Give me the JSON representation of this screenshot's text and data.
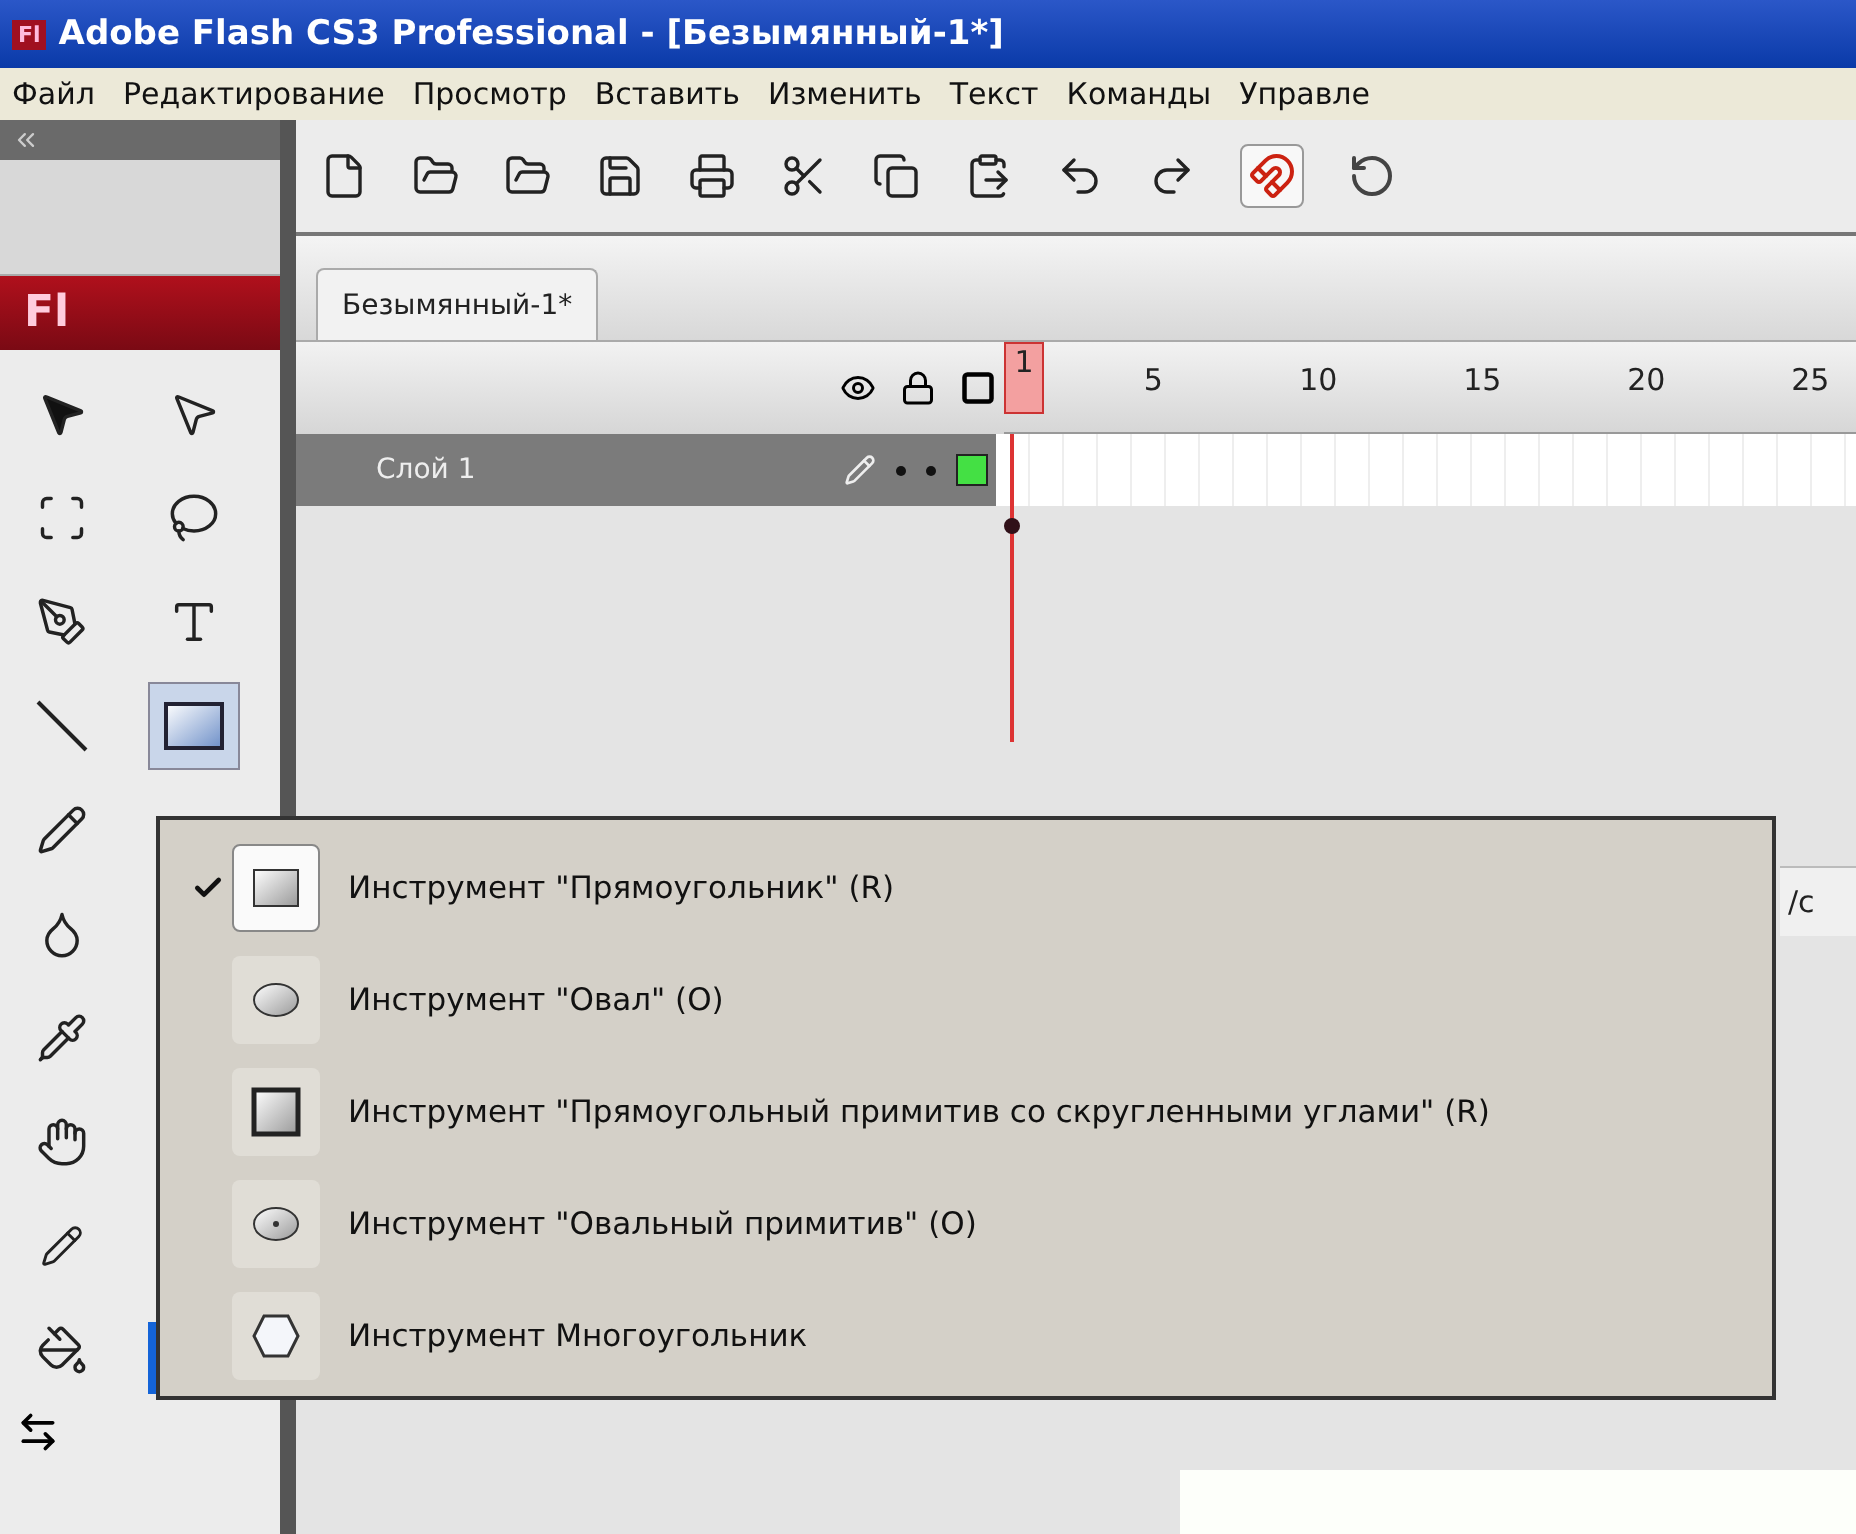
{
  "window": {
    "app_badge": "Fl",
    "title": "Adobe Flash CS3 Professional - [Безымянный-1*]"
  },
  "menu": [
    "Файл",
    "Редактирование",
    "Просмотр",
    "Вставить",
    "Изменить",
    "Текст",
    "Команды",
    "Управле"
  ],
  "tools_panel": {
    "logo": "Fl",
    "tools": [
      {
        "kind": "arrow",
        "selected": false
      },
      {
        "kind": "subselect",
        "selected": false
      },
      {
        "kind": "transform",
        "selected": false
      },
      {
        "kind": "lasso",
        "selected": false
      },
      {
        "kind": "pen",
        "selected": false
      },
      {
        "kind": "text",
        "selected": false
      },
      {
        "kind": "line",
        "selected": false
      },
      {
        "kind": "rectangle",
        "selected": true
      },
      {
        "kind": "pencil",
        "selected": false
      },
      {
        "kind": "inkbottle",
        "selected": false
      },
      {
        "kind": "eyedropper",
        "selected": false
      },
      {
        "kind": "hand",
        "selected": false
      },
      {
        "kind": "stroke",
        "selected": false
      },
      {
        "kind": "fill",
        "selected": false
      }
    ]
  },
  "document_tabs": [
    {
      "label": "Безымянный-1*",
      "selected": true
    }
  ],
  "timeline": {
    "frames": [
      {
        "label": "1",
        "selected": true
      },
      {
        "label": "5",
        "selected": false
      },
      {
        "label": "10",
        "selected": false
      },
      {
        "label": "15",
        "selected": false
      },
      {
        "label": "20",
        "selected": false
      },
      {
        "label": "25",
        "selected": false
      }
    ],
    "layers": [
      {
        "name": "Слой 1",
        "selected": true
      }
    ]
  },
  "status_fragment": "/c",
  "popup_menu": [
    {
      "kind": "rectangle",
      "label": "Инструмент \"Прямоугольник\" (R)",
      "checked": true
    },
    {
      "kind": "oval",
      "label": "Инструмент \"Овал\" (O)",
      "checked": false
    },
    {
      "kind": "rounded",
      "label": "Инструмент \"Прямоугольный примитив со скругленными углами\" (R)",
      "checked": false
    },
    {
      "kind": "ovalprim",
      "label": "Инструмент \"Овальный примитив\" (O)",
      "checked": false
    },
    {
      "kind": "polygon",
      "label": "Инструмент Многоугольник",
      "checked": false
    }
  ]
}
